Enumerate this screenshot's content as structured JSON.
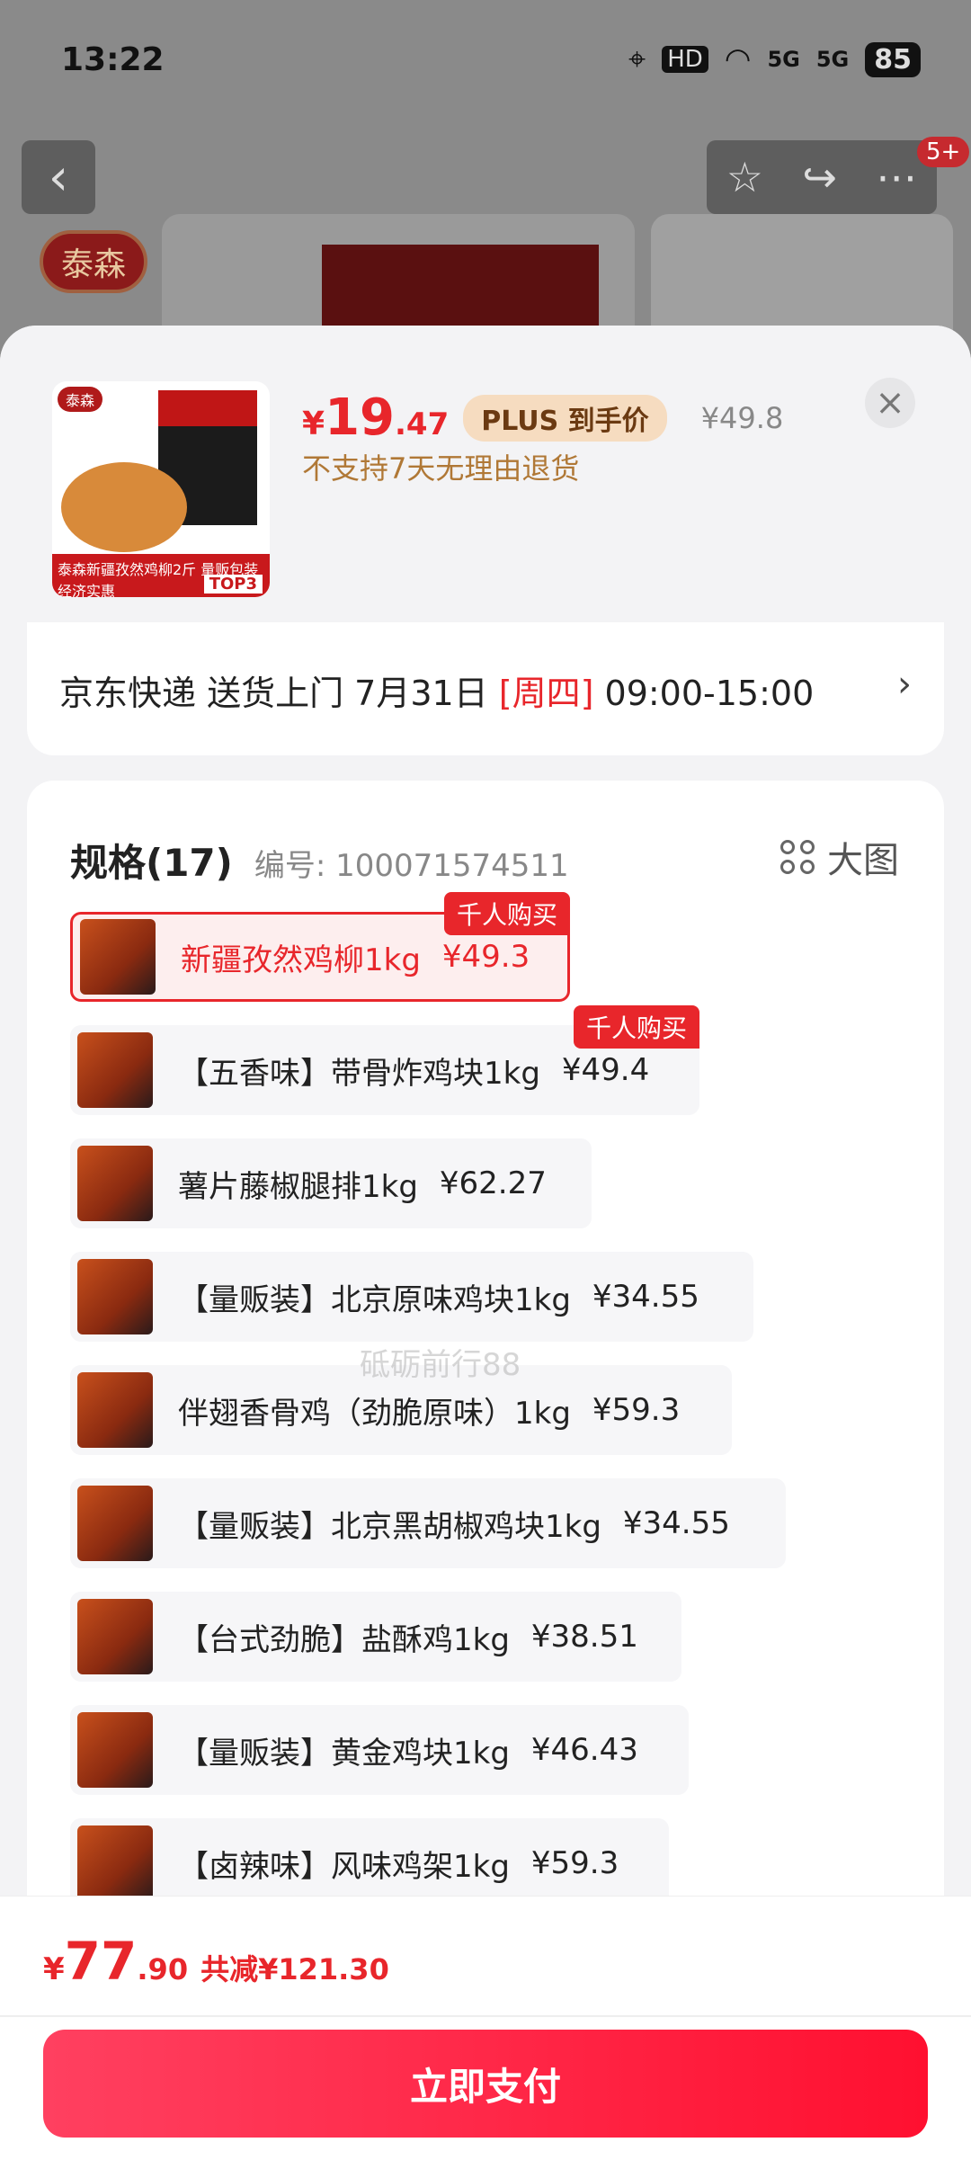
{
  "status_bar": {
    "time": "13:22",
    "hd": "HD",
    "net1": "5G",
    "net2": "5G",
    "battery": "85"
  },
  "background": {
    "brand_logo": "泰森",
    "cart_badge": "5+"
  },
  "product": {
    "price_currency": "¥",
    "price_int": "19",
    "price_dec": ".47",
    "plus_label": "PLUS 到手价",
    "original_price": "¥49.8",
    "return_policy": "不支持7天无理由退货",
    "thumb_logo": "泰森",
    "thumb_banner": "泰森新疆孜然鸡柳2斤 量贩包装 经济实惠",
    "thumb_top": "TOP3"
  },
  "delivery": {
    "text": "京东快递 送货上门 7月31日 ",
    "day": "[周四]",
    "time": " 09:00-15:00",
    "arrow": "›"
  },
  "specs": {
    "title": "规格(17)",
    "item_no": "编号: 100071574511",
    "big_view": "大图",
    "options": [
      {
        "label": "新疆孜然鸡柳1kg",
        "price": "¥49.3",
        "selected": true,
        "tag": "千人购买"
      },
      {
        "label": "【五香味】带骨炸鸡块1kg",
        "price": "¥49.4",
        "selected": false,
        "tag": "千人购买"
      },
      {
        "label": "薯片藤椒腿排1kg",
        "price": "¥62.27",
        "selected": false,
        "tag": ""
      },
      {
        "label": "【量贩装】北京原味鸡块1kg",
        "price": "¥34.55",
        "selected": false,
        "tag": ""
      },
      {
        "label": "伴翅香骨鸡（劲脆原味）1kg",
        "price": "¥59.3",
        "selected": false,
        "tag": ""
      },
      {
        "label": "【量贩装】北京黑胡椒鸡块1kg",
        "price": "¥34.55",
        "selected": false,
        "tag": ""
      },
      {
        "label": "【台式劲脆】盐酥鸡1kg",
        "price": "¥38.51",
        "selected": false,
        "tag": ""
      },
      {
        "label": "【量贩装】黄金鸡块1kg",
        "price": "¥46.43",
        "selected": false,
        "tag": ""
      },
      {
        "label": "【卤辣味】风味鸡架1kg",
        "price": "¥59.3",
        "selected": false,
        "tag": ""
      }
    ],
    "watermark": "砥砺前行88"
  },
  "checkout": {
    "currency": "¥",
    "total_int": "77",
    "total_dec": ".90",
    "saving": "共减¥121.30",
    "pay_button": "立即支付"
  },
  "colors": {
    "accent": "#e8262b",
    "plus_bg": "#f6dcc0",
    "return_text": "#b07836"
  }
}
